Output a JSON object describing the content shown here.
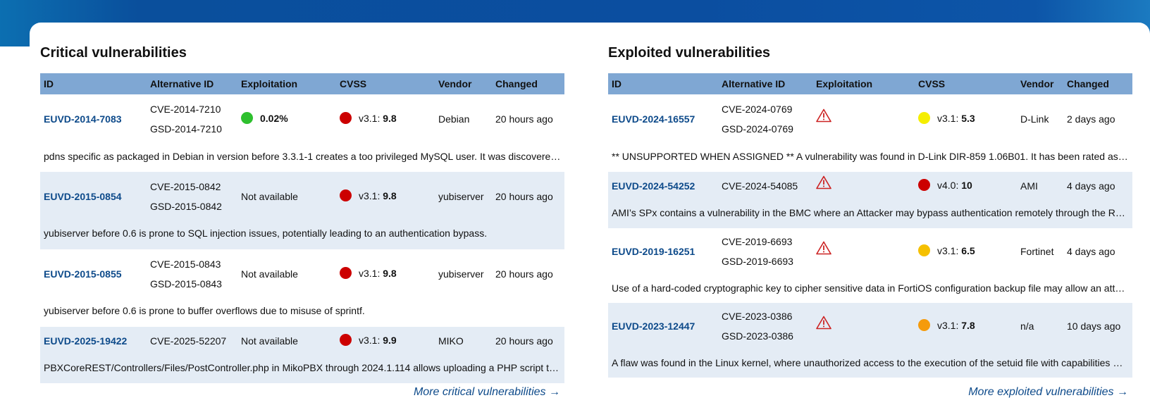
{
  "critical": {
    "title": "Critical vulnerabilities",
    "columns": [
      "ID",
      "Alternative ID",
      "Exploitation",
      "CVSS",
      "Vendor",
      "Changed"
    ],
    "rows": [
      {
        "id": "EUVD-2014-7083",
        "alt_ids": [
          "CVE-2014-7210",
          "GSD-2014-7210"
        ],
        "exploitation": "0.02%",
        "exploitation_color": "#2ec02e",
        "cvss_version": "v3.1: ",
        "cvss_score": "9.8",
        "cvss_color": "#cc0000",
        "vendor": "Debian",
        "changed": "20 hours ago",
        "description": "pdns specific as packaged in Debian in version before 3.3.1-1 creates a too privileged MySQL user. It was discovered that the potential for..."
      },
      {
        "id": "EUVD-2015-0854",
        "alt_ids": [
          "CVE-2015-0842",
          "GSD-2015-0842"
        ],
        "exploitation": "Not available",
        "cvss_version": "v3.1: ",
        "cvss_score": "9.8",
        "cvss_color": "#cc0000",
        "vendor": "yubiserver",
        "changed": "20 hours ago",
        "description": "yubiserver before 0.6 is prone to SQL injection issues, potentially leading to an authentication bypass."
      },
      {
        "id": "EUVD-2015-0855",
        "alt_ids": [
          "CVE-2015-0843",
          "GSD-2015-0843"
        ],
        "exploitation": "Not available",
        "cvss_version": "v3.1: ",
        "cvss_score": "9.8",
        "cvss_color": "#cc0000",
        "vendor": "yubiserver",
        "changed": "20 hours ago",
        "description": "yubiserver before 0.6 is prone to buffer overflows due to misuse of sprintf."
      },
      {
        "id": "EUVD-2025-19422",
        "alt_ids": [
          "CVE-2025-52207"
        ],
        "exploitation": "Not available",
        "cvss_version": "v3.1: ",
        "cvss_score": "9.9",
        "cvss_color": "#cc0000",
        "vendor": "MIKO",
        "changed": "20 hours ago",
        "description": "PBXCoreREST/Controllers/Files/PostController.php in MikoPBX through 2024.1.114 allows uploading a PHP script to an arbitrary directory."
      }
    ],
    "more_label": "More critical vulnerabilities →"
  },
  "exploited": {
    "title": "Exploited vulnerabilities",
    "columns": [
      "ID",
      "Alternative ID",
      "Exploitation",
      "CVSS",
      "Vendor",
      "Changed"
    ],
    "exploitation_icon": "warning-triangle-icon",
    "rows": [
      {
        "id": "EUVD-2024-16557",
        "alt_ids": [
          "CVE-2024-0769",
          "GSD-2024-0769"
        ],
        "cvss_version": "v3.1: ",
        "cvss_score": "5.3",
        "cvss_color": "#f5ee00",
        "vendor": "D-Link",
        "changed": "2 days ago",
        "description": "** UNSUPPORTED WHEN ASSIGNED ** A vulnerability was found in D-Link DIR-859 1.06B01. It has been rated as critical. Affected by this issue..."
      },
      {
        "id": "EUVD-2024-54252",
        "alt_ids": [
          "CVE-2024-54085"
        ],
        "cvss_version": "v4.0: ",
        "cvss_score": "10",
        "cvss_color": "#cc0000",
        "vendor": "AMI",
        "changed": "4 days ago",
        "description": "AMI’s SPx contains a vulnerability in the BMC where an Attacker may bypass authentication remotely through the Redfish Host Interface."
      },
      {
        "id": "EUVD-2019-16251",
        "alt_ids": [
          "CVE-2019-6693",
          "GSD-2019-6693"
        ],
        "cvss_version": "v3.1: ",
        "cvss_score": "6.5",
        "cvss_color": "#f5c000",
        "vendor": "Fortinet",
        "changed": "4 days ago",
        "description": "Use of a hard-coded cryptographic key to cipher sensitive data in FortiOS configuration backup file may allow an attacker with access to the backup file..."
      },
      {
        "id": "EUVD-2023-12447",
        "alt_ids": [
          "CVE-2023-0386",
          "GSD-2023-0386"
        ],
        "cvss_version": "v3.1: ",
        "cvss_score": "7.8",
        "cvss_color": "#f59b0c",
        "vendor": "n/a",
        "changed": "10 days ago",
        "description": "A flaw was found in the Linux kernel, where unauthorized access to the execution of the setuid file with capabilities was found in the kernel..."
      }
    ],
    "more_label": "More exploited vulnerabilities →"
  },
  "colors": {
    "header_row": "#7fa7d3",
    "alt_row": "#e4ecf5",
    "link": "#0d4a8a",
    "warning_icon": "#cc2222"
  }
}
